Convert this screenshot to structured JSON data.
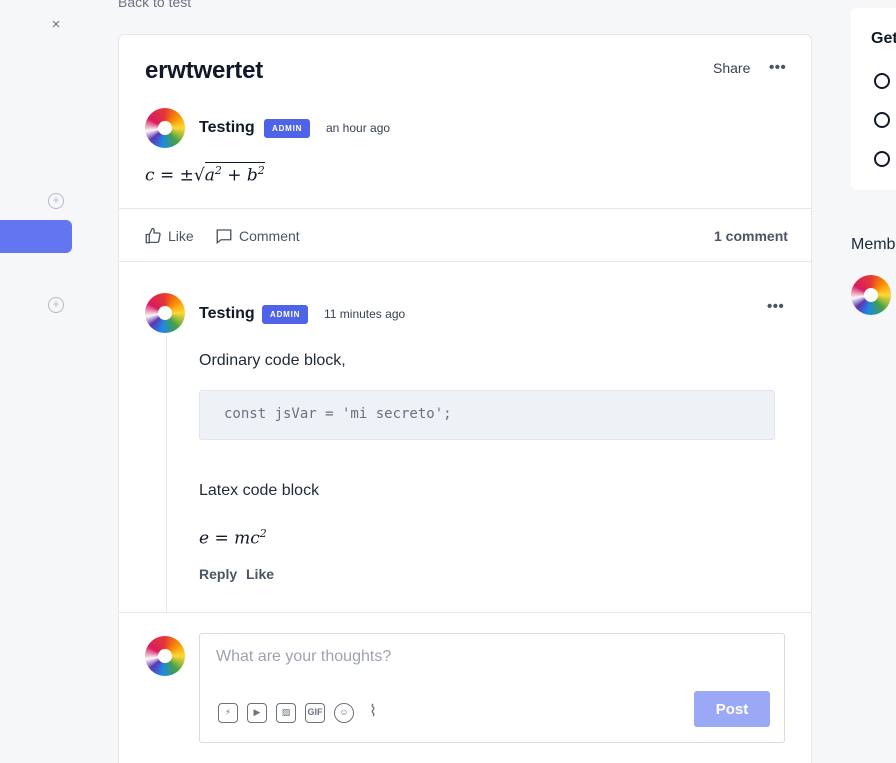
{
  "nav": {
    "back_label": "Back to test",
    "close_glyph": "×"
  },
  "post": {
    "title": "erwtwertet",
    "share_label": "Share",
    "more_glyph": "•••",
    "author": "Testing",
    "badge": "ADMIN",
    "time": "an hour ago",
    "formula": {
      "lhs": "c",
      "eq": "=",
      "pm": "±",
      "a": "a",
      "b": "b",
      "exp": "2",
      "plus": "+"
    }
  },
  "actions": {
    "like": "Like",
    "comment": "Comment",
    "count": "1 comment"
  },
  "comment": {
    "author": "Testing",
    "badge": "ADMIN",
    "time": "11 minutes ago",
    "more_glyph": "•••",
    "intro": "Ordinary code block,",
    "code": "const jsVar = 'mi secreto';",
    "latex_label": "Latex code block",
    "formula": {
      "lhs": "e",
      "eq": "=",
      "rhs": "mc",
      "exp": "2"
    },
    "reply_label": "Reply",
    "like_label": "Like"
  },
  "composer": {
    "placeholder": "What are your thoughts?",
    "post_label": "Post",
    "tools": [
      "lightning-icon",
      "video-icon",
      "image-icon",
      "gif-icon",
      "emoji-icon",
      "attachment-icon"
    ],
    "gif_label": "GIF"
  },
  "sidebar": {
    "title_partial": "Get",
    "members_partial": "Memb"
  },
  "colors": {
    "accent": "#4f63e8",
    "post_button": "#9ba8f5",
    "active_nav": "#6375f0"
  }
}
